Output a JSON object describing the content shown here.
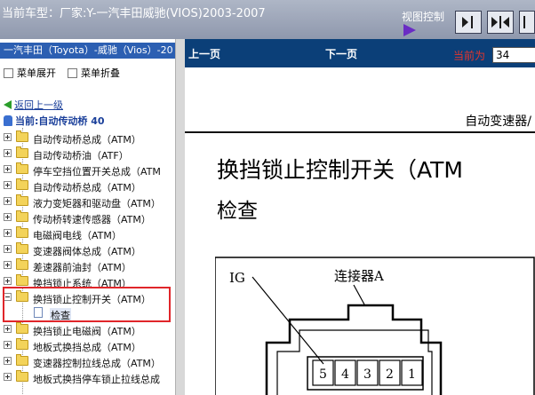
{
  "header": {
    "title": "当前车型：厂家:Y-一汽丰田威驰(VIOS)2003-2007",
    "view_control_label": "视图控制",
    "view_buttons": [
      "show-left-panel",
      "split-view",
      "hide-left-panel"
    ]
  },
  "left_panel": {
    "model": "一汽丰田（Toyota）-威驰（Vios）-20",
    "expand_all": "菜单展开",
    "collapse_all": "菜单折叠",
    "back_link": "返回上一级",
    "current": "当前:自动传动桥 40",
    "tree": [
      {
        "label": "自动传动桥总成（ATM）",
        "expanded": false
      },
      {
        "label": "自动传动桥油（ATF）",
        "expanded": false
      },
      {
        "label": "停车空挡位置开关总成（ATM",
        "expanded": false
      },
      {
        "label": "自动传动桥总成（ATM）",
        "expanded": false
      },
      {
        "label": "液力变矩器和驱动盘（ATM）",
        "expanded": false
      },
      {
        "label": "传动桥转速传感器（ATM）",
        "expanded": false
      },
      {
        "label": "电磁阀电线（ATM）",
        "expanded": false
      },
      {
        "label": "变速器阀体总成（ATM）",
        "expanded": false
      },
      {
        "label": "差速器前油封（ATM）",
        "expanded": false
      },
      {
        "label": "换挡锁止系统（ATM）",
        "expanded": false
      },
      {
        "label": "换挡锁止控制开关（ATM）",
        "expanded": true,
        "children": [
          "检查"
        ]
      },
      {
        "label": "换挡锁止电磁阀（ATM）",
        "expanded": false
      },
      {
        "label": "地板式换挡总成（ATM）",
        "expanded": false
      },
      {
        "label": "变速器控制拉线总成（ATM）",
        "expanded": false
      },
      {
        "label": "地板式换挡停车锁止拉线总成",
        "expanded": false
      }
    ]
  },
  "navigation": {
    "prev": "上一页",
    "next": "下一页",
    "page_label": "当前为",
    "page_value": "34"
  },
  "document": {
    "section": "自动变速器/",
    "title": "换挡锁止控制开关（ATM",
    "subtitle": "检查",
    "diagram": {
      "ig_label": "IG",
      "connector_label": "连接器A",
      "pins": [
        "5",
        "4",
        "3",
        "2",
        "1"
      ]
    }
  },
  "colors": {
    "top_bar": "#9aa2b6",
    "nav_bar": "#0b3f78",
    "model_bar": "#2c5fb2",
    "highlight": "#e0262a",
    "page_label": "#e4352c"
  }
}
